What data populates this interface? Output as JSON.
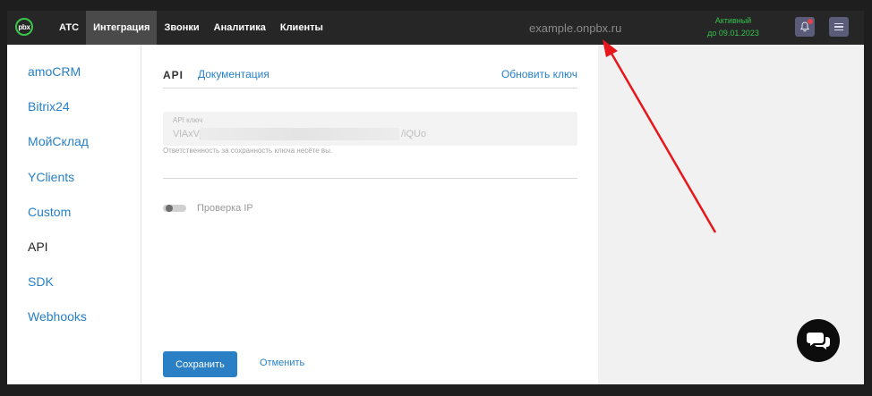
{
  "header": {
    "logo_text": "pbx",
    "nav": [
      {
        "label": "АТС",
        "active": false
      },
      {
        "label": "Интеграция",
        "active": true
      },
      {
        "label": "Звонки",
        "active": false
      },
      {
        "label": "Аналитика",
        "active": false
      },
      {
        "label": "Клиенты",
        "active": false
      }
    ],
    "domain": "example.onpbx.ru",
    "status": "Активный",
    "status_until": "до 09.01.2023",
    "notifications_icon": "bell-icon",
    "menu_icon": "hamburger-icon"
  },
  "sidebar": {
    "items": [
      {
        "label": "amoCRM",
        "active": false
      },
      {
        "label": "Bitrix24",
        "active": false
      },
      {
        "label": "МойСклад",
        "active": false
      },
      {
        "label": "YClients",
        "active": false
      },
      {
        "label": "Custom",
        "active": false
      },
      {
        "label": "API",
        "active": true
      },
      {
        "label": "SDK",
        "active": false
      },
      {
        "label": "Webhooks",
        "active": false
      }
    ]
  },
  "main": {
    "tab_api": "API",
    "tab_docs": "Документация",
    "refresh_key": "Обновить ключ",
    "key_field": {
      "label": "API ключ",
      "value_start": "VlAxVjF",
      "value_end": "/iQUo"
    },
    "key_hint": "Ответственность за сохранность ключа несёте вы.",
    "ip_check_label": "Проверка IP",
    "ip_check_enabled": false,
    "save_button": "Сохранить",
    "cancel_button": "Отменить"
  },
  "chat_icon": "chat-icon",
  "colors": {
    "accent": "#2780c6",
    "status": "#34c34a",
    "topbar": "#262626",
    "annotation_arrow": "#e8161a"
  }
}
